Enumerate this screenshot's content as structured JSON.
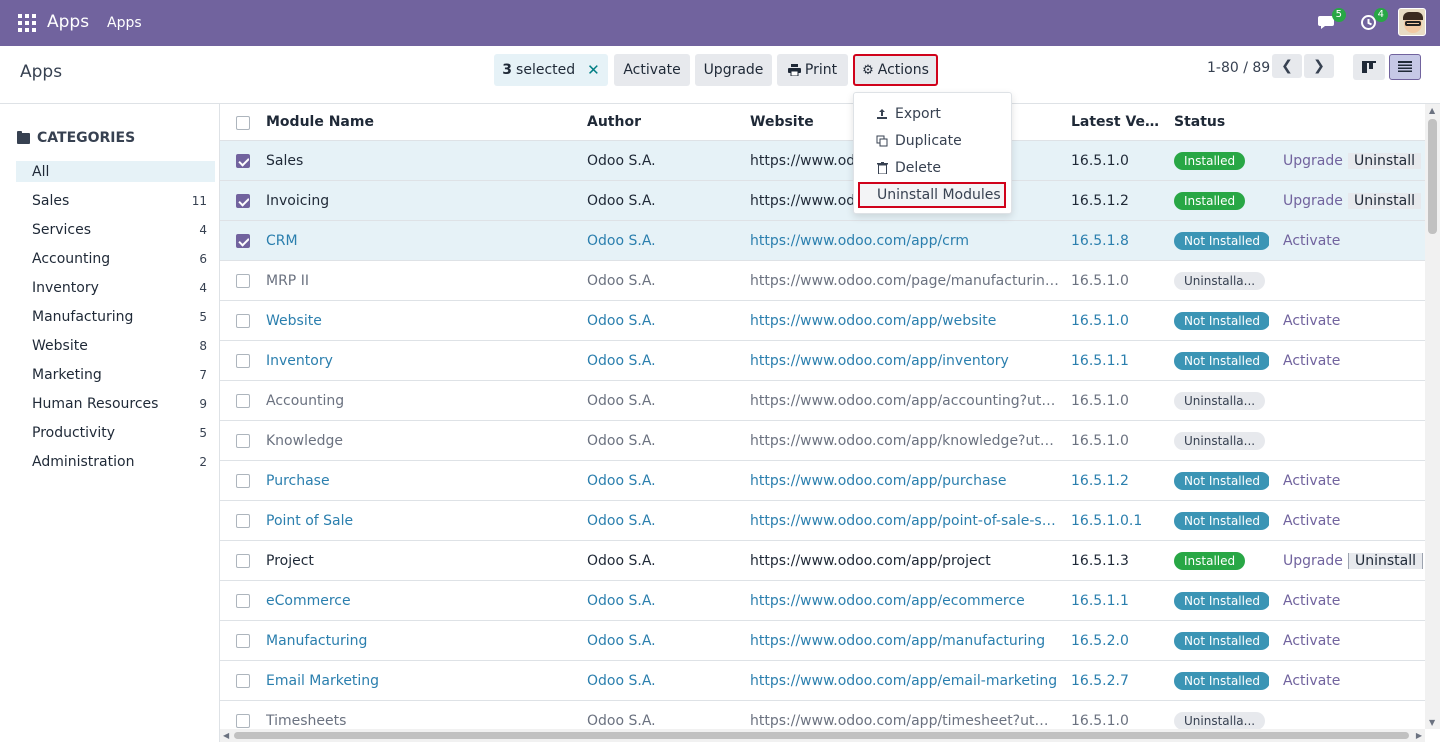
{
  "navbar": {
    "brand": "Apps",
    "menu": "Apps",
    "messages_count": "5",
    "activities_count": "4"
  },
  "control": {
    "breadcrumb": "Apps",
    "selected_count": "3",
    "selected_label": "selected",
    "activate": "Activate",
    "upgrade": "Upgrade",
    "print": "Print",
    "actions": "Actions",
    "pager": "1-80 / 89"
  },
  "actions_menu": {
    "export": "Export",
    "duplicate": "Duplicate",
    "delete": "Delete",
    "uninstall": "Uninstall Modules"
  },
  "sidebar": {
    "title": "CATEGORIES",
    "items": [
      {
        "label": "All",
        "count": ""
      },
      {
        "label": "Sales",
        "count": "11"
      },
      {
        "label": "Services",
        "count": "4"
      },
      {
        "label": "Accounting",
        "count": "6"
      },
      {
        "label": "Inventory",
        "count": "4"
      },
      {
        "label": "Manufacturing",
        "count": "5"
      },
      {
        "label": "Website",
        "count": "8"
      },
      {
        "label": "Marketing",
        "count": "7"
      },
      {
        "label": "Human Resources",
        "count": "9"
      },
      {
        "label": "Productivity",
        "count": "5"
      },
      {
        "label": "Administration",
        "count": "2"
      }
    ]
  },
  "table": {
    "headers": {
      "name": "Module Name",
      "author": "Author",
      "website": "Website",
      "version": "Latest Versi...",
      "status": "Status"
    },
    "rows": [
      {
        "name": "Sales",
        "author": "Odoo S.A.",
        "website": "https://www.odoo.com/app/sales",
        "version": "16.5.1.0",
        "status": "Installed",
        "action1": "Upgrade",
        "action2": "Uninstall"
      },
      {
        "name": "Invoicing",
        "author": "Odoo S.A.",
        "website": "https://www.odoo.com/app/invoicing",
        "version": "16.5.1.2",
        "status": "Installed",
        "action1": "Upgrade",
        "action2": "Uninstall"
      },
      {
        "name": "CRM",
        "author": "Odoo S.A.",
        "website": "https://www.odoo.com/app/crm",
        "version": "16.5.1.8",
        "status": "Not Installed",
        "action1": "Activate",
        "action2": ""
      },
      {
        "name": "MRP II",
        "author": "Odoo S.A.",
        "website": "https://www.odoo.com/page/manufacturing?u...",
        "version": "16.5.1.0",
        "status": "Uninstalla...",
        "action1": "",
        "action2": ""
      },
      {
        "name": "Website",
        "author": "Odoo S.A.",
        "website": "https://www.odoo.com/app/website",
        "version": "16.5.1.0",
        "status": "Not Installed",
        "action1": "Activate",
        "action2": ""
      },
      {
        "name": "Inventory",
        "author": "Odoo S.A.",
        "website": "https://www.odoo.com/app/inventory",
        "version": "16.5.1.1",
        "status": "Not Installed",
        "action1": "Activate",
        "action2": ""
      },
      {
        "name": "Accounting",
        "author": "Odoo S.A.",
        "website": "https://www.odoo.com/app/accounting?utm_s...",
        "version": "16.5.1.0",
        "status": "Uninstalla...",
        "action1": "",
        "action2": ""
      },
      {
        "name": "Knowledge",
        "author": "Odoo S.A.",
        "website": "https://www.odoo.com/app/knowledge?utm_s...",
        "version": "16.5.1.0",
        "status": "Uninstalla...",
        "action1": "",
        "action2": ""
      },
      {
        "name": "Purchase",
        "author": "Odoo S.A.",
        "website": "https://www.odoo.com/app/purchase",
        "version": "16.5.1.2",
        "status": "Not Installed",
        "action1": "Activate",
        "action2": ""
      },
      {
        "name": "Point of Sale",
        "author": "Odoo S.A.",
        "website": "https://www.odoo.com/app/point-of-sale-shop",
        "version": "16.5.1.0.1",
        "status": "Not Installed",
        "action1": "Activate",
        "action2": ""
      },
      {
        "name": "Project",
        "author": "Odoo S.A.",
        "website": "https://www.odoo.com/app/project",
        "version": "16.5.1.3",
        "status": "Installed",
        "action1": "Upgrade",
        "action2": "Uninstall"
      },
      {
        "name": "eCommerce",
        "author": "Odoo S.A.",
        "website": "https://www.odoo.com/app/ecommerce",
        "version": "16.5.1.1",
        "status": "Not Installed",
        "action1": "Activate",
        "action2": ""
      },
      {
        "name": "Manufacturing",
        "author": "Odoo S.A.",
        "website": "https://www.odoo.com/app/manufacturing",
        "version": "16.5.2.0",
        "status": "Not Installed",
        "action1": "Activate",
        "action2": ""
      },
      {
        "name": "Email Marketing",
        "author": "Odoo S.A.",
        "website": "https://www.odoo.com/app/email-marketing",
        "version": "16.5.2.7",
        "status": "Not Installed",
        "action1": "Activate",
        "action2": ""
      },
      {
        "name": "Timesheets",
        "author": "Odoo S.A.",
        "website": "https://www.odoo.com/app/timesheet?utm_s...",
        "version": "16.5.1.0",
        "status": "Uninstalla...",
        "action1": "",
        "action2": ""
      }
    ]
  },
  "colors": {
    "navbar": "#71639e",
    "selected_row": "#e6f2f7",
    "installed": "#28a745",
    "not_installed": "#3b95b5",
    "highlight_border": "#d0021b"
  }
}
